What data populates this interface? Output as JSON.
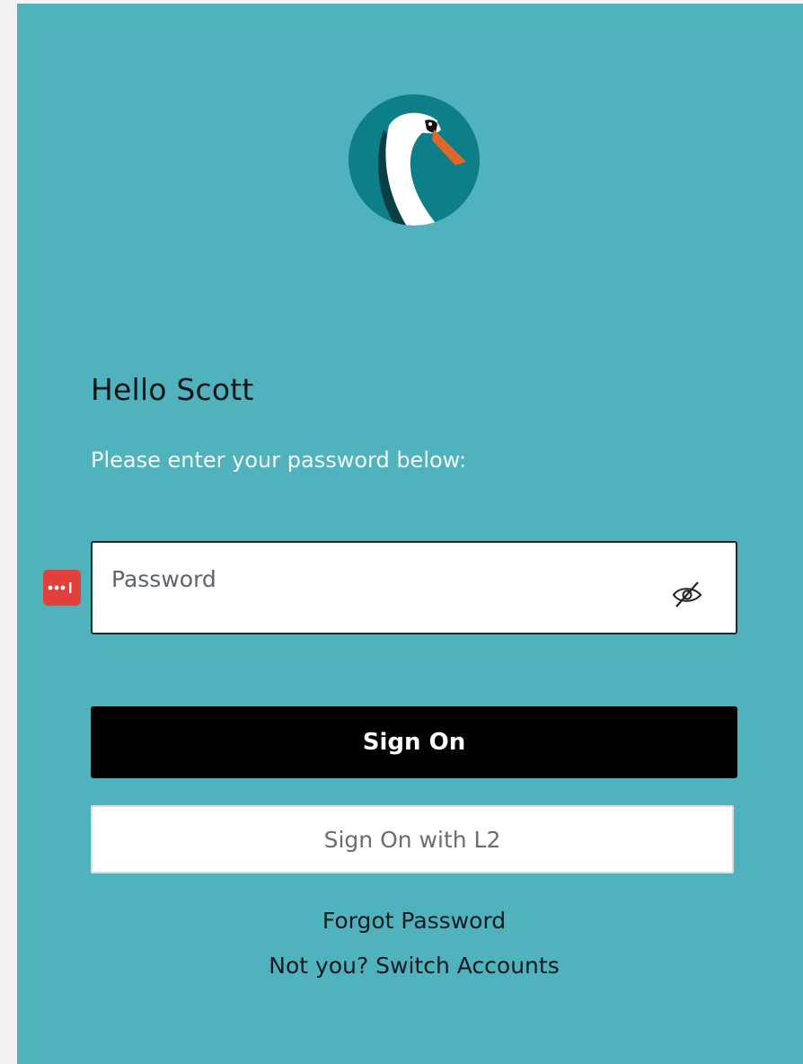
{
  "greeting": "Hello Scott",
  "instruction": "Please enter your password below:",
  "password_field": {
    "placeholder": "Password",
    "value": "",
    "visibility_icon": "eye-slash-icon"
  },
  "password_manager_icon": "password-manager-icon",
  "buttons": {
    "sign_on": "Sign On",
    "sign_on_l2": "Sign On with L2"
  },
  "links": {
    "forgot_password": "Forgot Password",
    "switch_accounts": "Not you? Switch Accounts"
  },
  "logo_icon": "swan-logo-icon",
  "colors": {
    "background": "#50b2bd",
    "primary_button": "#000000",
    "password_manager": "#e1413a",
    "logo_circle": "#0e7e88",
    "beak": "#e0662c"
  }
}
